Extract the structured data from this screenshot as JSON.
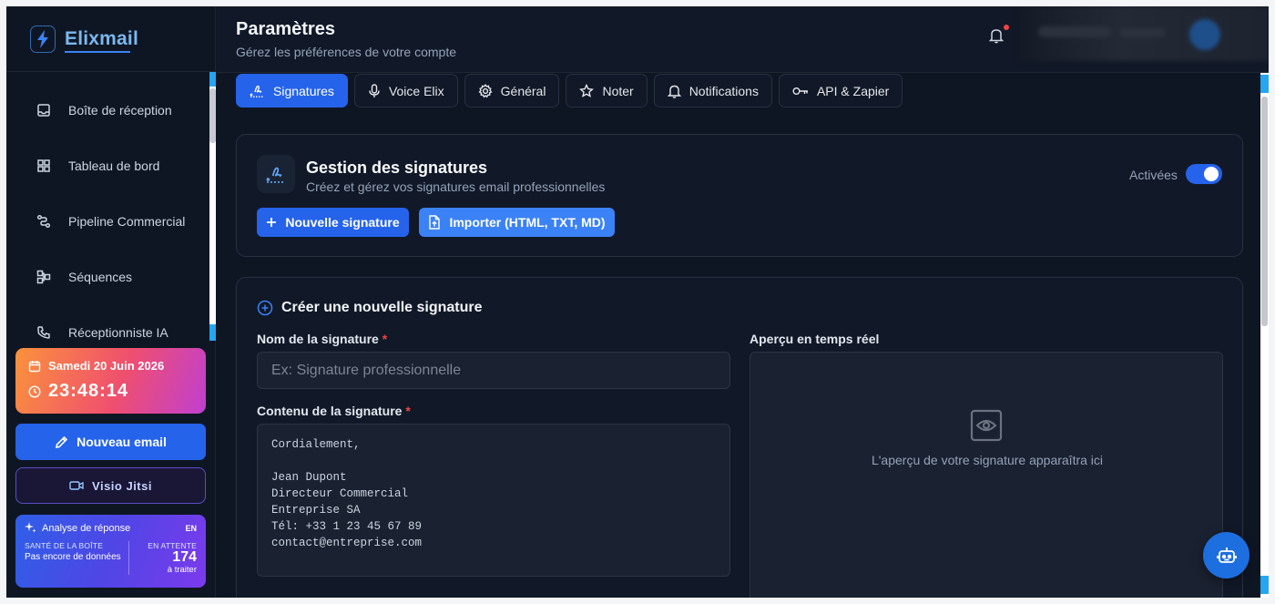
{
  "app": {
    "name": "Elixmail"
  },
  "sidebar": {
    "items": [
      {
        "label": "Boîte de réception",
        "icon": "inbox-icon"
      },
      {
        "label": "Tableau de bord",
        "icon": "dashboard-icon"
      },
      {
        "label": "Pipeline Commercial",
        "icon": "pipeline-icon"
      },
      {
        "label": "Séquences",
        "icon": "sequences-icon"
      },
      {
        "label": "Réceptionniste IA",
        "icon": "phone-icon"
      }
    ],
    "date": "Samedi 20 Juin 2026",
    "time": "23:48:14",
    "new_email": "Nouveau email",
    "visio": "Visio Jitsi",
    "analysis": {
      "title": "Analyse de réponse",
      "lang": "EN",
      "health_label": "SANTÉ DE LA BOÎTE",
      "health_text": "Pas encore de données",
      "pending_label": "EN ATTENTE",
      "pending_count": "174",
      "pending_sub": "à traiter"
    }
  },
  "header": {
    "title": "Paramètres",
    "subtitle": "Gérez les préférences de votre compte"
  },
  "tabs": [
    {
      "label": "Signatures",
      "icon": "signature-icon",
      "active": true
    },
    {
      "label": "Voice Elix",
      "icon": "microphone-icon"
    },
    {
      "label": "Général",
      "icon": "gear-icon"
    },
    {
      "label": "Noter",
      "icon": "star-icon"
    },
    {
      "label": "Notifications",
      "icon": "bell-icon"
    },
    {
      "label": "API & Zapier",
      "icon": "key-icon"
    }
  ],
  "signatures": {
    "title": "Gestion des signatures",
    "subtitle": "Créez et gérez vos signatures email professionnelles",
    "toggle_label": "Activées",
    "enabled": true,
    "new_button": "Nouvelle signature",
    "import_button": "Importer (HTML, TXT, MD)"
  },
  "create": {
    "title": "Créer une nouvelle signature",
    "name_label": "Nom de la signature",
    "required_mark": "*",
    "name_placeholder": "Ex: Signature professionnelle",
    "content_label": "Contenu de la signature",
    "content_value": "Cordialement,\n\nJean Dupont\nDirecteur Commercial\nEntreprise SA\nTél: +33 1 23 45 67 89\ncontact@entreprise.com",
    "preview_label": "Aperçu en temps réel",
    "preview_empty": "L'aperçu de votre signature apparaîtra ici"
  },
  "colors": {
    "accent": "#2563eb",
    "background": "#0f1623",
    "danger": "#ef4444"
  }
}
